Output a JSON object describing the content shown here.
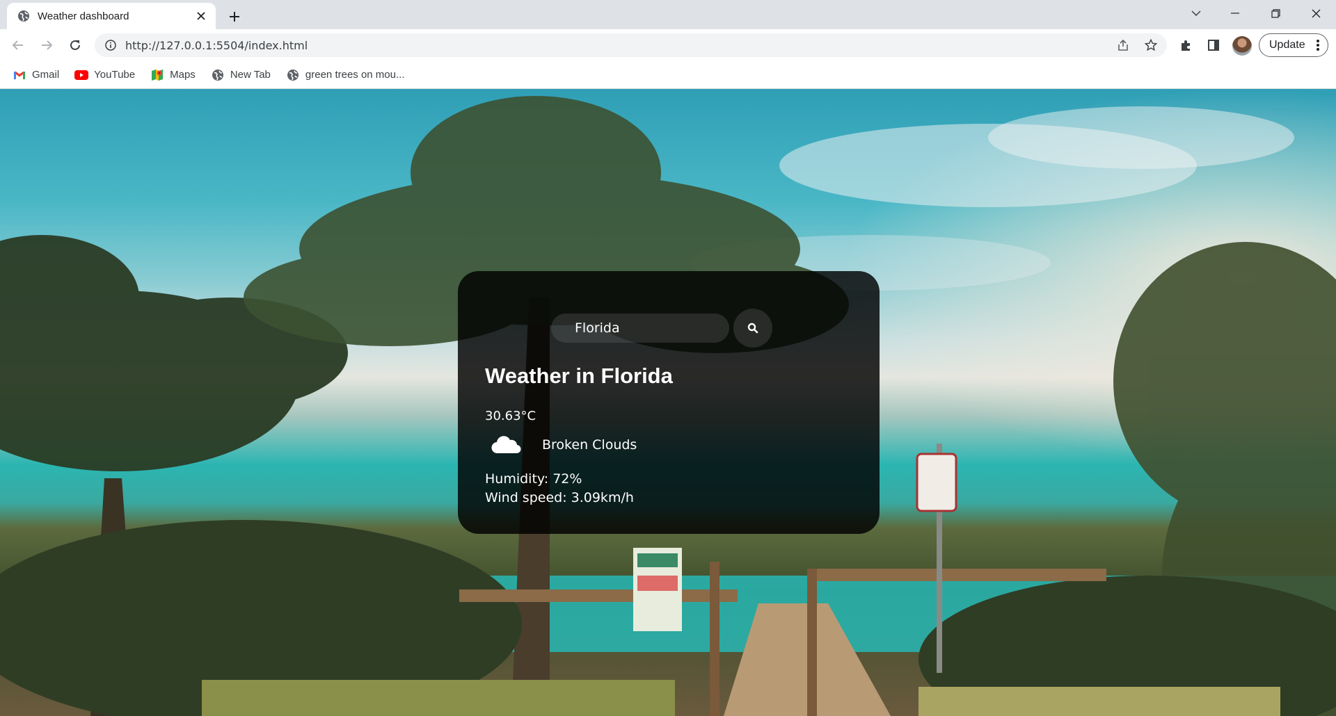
{
  "browser": {
    "tab": {
      "title": "Weather dashboard",
      "favicon": "globe-icon"
    },
    "url": "http://127.0.0.1:5504/index.html",
    "update_label": "Update",
    "bookmarks": [
      {
        "label": "Gmail",
        "icon": "gmail-icon"
      },
      {
        "label": "YouTube",
        "icon": "youtube-icon"
      },
      {
        "label": "Maps",
        "icon": "maps-icon"
      },
      {
        "label": "New Tab",
        "icon": "globe-icon"
      },
      {
        "label": "green trees on mou...",
        "icon": "globe-icon"
      }
    ]
  },
  "weather": {
    "search": {
      "value": "Florida",
      "placeholder": ""
    },
    "city_heading": "Weather in Florida",
    "temperature": "30.63°C",
    "description": "Broken Clouds",
    "icon": "cloud-icon",
    "humidity": "Humidity: 72%",
    "wind": "Wind speed: 3.09km/h"
  },
  "colors": {
    "card_background": "#000000",
    "text": "#ffffff",
    "chrome_frame": "#dee1e6"
  }
}
